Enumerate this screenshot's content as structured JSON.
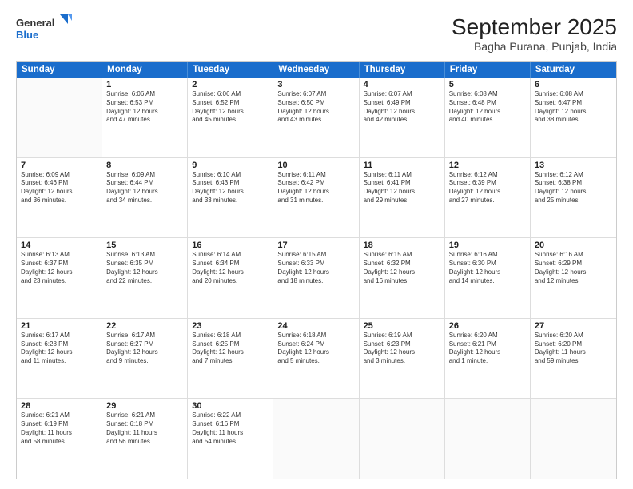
{
  "logo": {
    "general": "General",
    "blue": "Blue"
  },
  "title": "September 2025",
  "subtitle": "Bagha Purana, Punjab, India",
  "days": [
    "Sunday",
    "Monday",
    "Tuesday",
    "Wednesday",
    "Thursday",
    "Friday",
    "Saturday"
  ],
  "rows": [
    [
      {
        "num": "",
        "info": ""
      },
      {
        "num": "1",
        "info": "Sunrise: 6:06 AM\nSunset: 6:53 PM\nDaylight: 12 hours\nand 47 minutes."
      },
      {
        "num": "2",
        "info": "Sunrise: 6:06 AM\nSunset: 6:52 PM\nDaylight: 12 hours\nand 45 minutes."
      },
      {
        "num": "3",
        "info": "Sunrise: 6:07 AM\nSunset: 6:50 PM\nDaylight: 12 hours\nand 43 minutes."
      },
      {
        "num": "4",
        "info": "Sunrise: 6:07 AM\nSunset: 6:49 PM\nDaylight: 12 hours\nand 42 minutes."
      },
      {
        "num": "5",
        "info": "Sunrise: 6:08 AM\nSunset: 6:48 PM\nDaylight: 12 hours\nand 40 minutes."
      },
      {
        "num": "6",
        "info": "Sunrise: 6:08 AM\nSunset: 6:47 PM\nDaylight: 12 hours\nand 38 minutes."
      }
    ],
    [
      {
        "num": "7",
        "info": "Sunrise: 6:09 AM\nSunset: 6:46 PM\nDaylight: 12 hours\nand 36 minutes."
      },
      {
        "num": "8",
        "info": "Sunrise: 6:09 AM\nSunset: 6:44 PM\nDaylight: 12 hours\nand 34 minutes."
      },
      {
        "num": "9",
        "info": "Sunrise: 6:10 AM\nSunset: 6:43 PM\nDaylight: 12 hours\nand 33 minutes."
      },
      {
        "num": "10",
        "info": "Sunrise: 6:11 AM\nSunset: 6:42 PM\nDaylight: 12 hours\nand 31 minutes."
      },
      {
        "num": "11",
        "info": "Sunrise: 6:11 AM\nSunset: 6:41 PM\nDaylight: 12 hours\nand 29 minutes."
      },
      {
        "num": "12",
        "info": "Sunrise: 6:12 AM\nSunset: 6:39 PM\nDaylight: 12 hours\nand 27 minutes."
      },
      {
        "num": "13",
        "info": "Sunrise: 6:12 AM\nSunset: 6:38 PM\nDaylight: 12 hours\nand 25 minutes."
      }
    ],
    [
      {
        "num": "14",
        "info": "Sunrise: 6:13 AM\nSunset: 6:37 PM\nDaylight: 12 hours\nand 23 minutes."
      },
      {
        "num": "15",
        "info": "Sunrise: 6:13 AM\nSunset: 6:35 PM\nDaylight: 12 hours\nand 22 minutes."
      },
      {
        "num": "16",
        "info": "Sunrise: 6:14 AM\nSunset: 6:34 PM\nDaylight: 12 hours\nand 20 minutes."
      },
      {
        "num": "17",
        "info": "Sunrise: 6:15 AM\nSunset: 6:33 PM\nDaylight: 12 hours\nand 18 minutes."
      },
      {
        "num": "18",
        "info": "Sunrise: 6:15 AM\nSunset: 6:32 PM\nDaylight: 12 hours\nand 16 minutes."
      },
      {
        "num": "19",
        "info": "Sunrise: 6:16 AM\nSunset: 6:30 PM\nDaylight: 12 hours\nand 14 minutes."
      },
      {
        "num": "20",
        "info": "Sunrise: 6:16 AM\nSunset: 6:29 PM\nDaylight: 12 hours\nand 12 minutes."
      }
    ],
    [
      {
        "num": "21",
        "info": "Sunrise: 6:17 AM\nSunset: 6:28 PM\nDaylight: 12 hours\nand 11 minutes."
      },
      {
        "num": "22",
        "info": "Sunrise: 6:17 AM\nSunset: 6:27 PM\nDaylight: 12 hours\nand 9 minutes."
      },
      {
        "num": "23",
        "info": "Sunrise: 6:18 AM\nSunset: 6:25 PM\nDaylight: 12 hours\nand 7 minutes."
      },
      {
        "num": "24",
        "info": "Sunrise: 6:18 AM\nSunset: 6:24 PM\nDaylight: 12 hours\nand 5 minutes."
      },
      {
        "num": "25",
        "info": "Sunrise: 6:19 AM\nSunset: 6:23 PM\nDaylight: 12 hours\nand 3 minutes."
      },
      {
        "num": "26",
        "info": "Sunrise: 6:20 AM\nSunset: 6:21 PM\nDaylight: 12 hours\nand 1 minute."
      },
      {
        "num": "27",
        "info": "Sunrise: 6:20 AM\nSunset: 6:20 PM\nDaylight: 11 hours\nand 59 minutes."
      }
    ],
    [
      {
        "num": "28",
        "info": "Sunrise: 6:21 AM\nSunset: 6:19 PM\nDaylight: 11 hours\nand 58 minutes."
      },
      {
        "num": "29",
        "info": "Sunrise: 6:21 AM\nSunset: 6:18 PM\nDaylight: 11 hours\nand 56 minutes."
      },
      {
        "num": "30",
        "info": "Sunrise: 6:22 AM\nSunset: 6:16 PM\nDaylight: 11 hours\nand 54 minutes."
      },
      {
        "num": "",
        "info": ""
      },
      {
        "num": "",
        "info": ""
      },
      {
        "num": "",
        "info": ""
      },
      {
        "num": "",
        "info": ""
      }
    ]
  ]
}
